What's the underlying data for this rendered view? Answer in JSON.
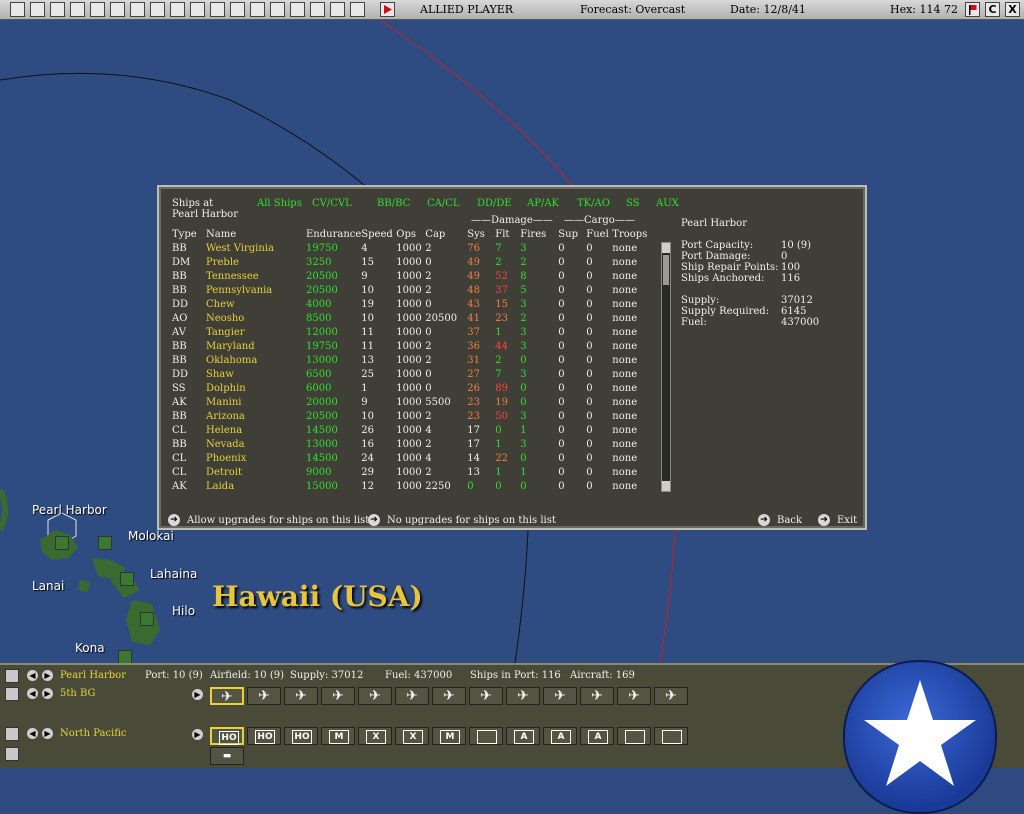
{
  "topbar": {
    "player": "ALLIED PLAYER",
    "forecast": "Forecast: Overcast",
    "date": "Date: 12/8/41",
    "hex": "Hex: 114  72",
    "right_c": "C",
    "right_x": "X"
  },
  "map": {
    "labels": {
      "pearl_harbor": "Pearl Harbor",
      "molokai": "Molokai",
      "lahaina": "Lahaina",
      "lanai": "Lanai",
      "hilo": "Hilo",
      "kona": "Kona",
      "hawaii": "Hawaii (USA)"
    }
  },
  "panel": {
    "header_line1": "Ships at",
    "header_line2": "Pearl Harbor",
    "filters": [
      "All Ships",
      "CV/CVL",
      "BB/BC",
      "CA/CL",
      "DD/DE",
      "AP/AK",
      "TK/AO",
      "SS",
      "AUX"
    ],
    "group_damage": "Damage",
    "group_cargo": "Cargo",
    "columns": [
      "Type",
      "Name",
      "Endurance",
      "Speed",
      "Ops",
      "Cap",
      "Sys",
      "Flt",
      "Fires",
      "Sup",
      "Fuel",
      "Troops"
    ],
    "rows": [
      [
        "BB",
        "West Virginia",
        "19750",
        "4",
        "1000",
        "2",
        "76",
        "7",
        "3",
        "0",
        "0",
        "none"
      ],
      [
        "DM",
        "Preble",
        "3250",
        "15",
        "1000",
        "0",
        "49",
        "2",
        "2",
        "0",
        "0",
        "none"
      ],
      [
        "BB",
        "Tennessee",
        "20500",
        "9",
        "1000",
        "2",
        "49",
        "52",
        "8",
        "0",
        "0",
        "none"
      ],
      [
        "BB",
        "Pennsylvania",
        "20500",
        "10",
        "1000",
        "2",
        "48",
        "37",
        "5",
        "0",
        "0",
        "none"
      ],
      [
        "DD",
        "Chew",
        "4000",
        "19",
        "1000",
        "0",
        "43",
        "15",
        "3",
        "0",
        "0",
        "none"
      ],
      [
        "AO",
        "Neosho",
        "8500",
        "10",
        "1000",
        "20500",
        "41",
        "23",
        "2",
        "0",
        "0",
        "none"
      ],
      [
        "AV",
        "Tangier",
        "12000",
        "11",
        "1000",
        "0",
        "37",
        "1",
        "3",
        "0",
        "0",
        "none"
      ],
      [
        "BB",
        "Maryland",
        "19750",
        "11",
        "1000",
        "2",
        "36",
        "44",
        "3",
        "0",
        "0",
        "none"
      ],
      [
        "BB",
        "Oklahoma",
        "13000",
        "13",
        "1000",
        "2",
        "31",
        "2",
        "0",
        "0",
        "0",
        "none"
      ],
      [
        "DD",
        "Shaw",
        "6500",
        "25",
        "1000",
        "0",
        "27",
        "7",
        "3",
        "0",
        "0",
        "none"
      ],
      [
        "SS",
        "Dolphin",
        "6000",
        "1",
        "1000",
        "0",
        "26",
        "89",
        "0",
        "0",
        "0",
        "none"
      ],
      [
        "AK",
        "Manini",
        "20000",
        "9",
        "1000",
        "5500",
        "23",
        "19",
        "0",
        "0",
        "0",
        "none"
      ],
      [
        "BB",
        "Arizona",
        "20500",
        "10",
        "1000",
        "2",
        "23",
        "50",
        "3",
        "0",
        "0",
        "none"
      ],
      [
        "CL",
        "Helena",
        "14500",
        "26",
        "1000",
        "4",
        "17",
        "0",
        "1",
        "0",
        "0",
        "none"
      ],
      [
        "BB",
        "Nevada",
        "13000",
        "16",
        "1000",
        "2",
        "17",
        "1",
        "3",
        "0",
        "0",
        "none"
      ],
      [
        "CL",
        "Phoenix",
        "14500",
        "24",
        "1000",
        "4",
        "14",
        "22",
        "0",
        "0",
        "0",
        "none"
      ],
      [
        "CL",
        "Detroit",
        "9000",
        "29",
        "1000",
        "2",
        "13",
        "1",
        "1",
        "0",
        "0",
        "none"
      ],
      [
        "AK",
        "Laida",
        "15000",
        "12",
        "1000",
        "2250",
        "0",
        "0",
        "0",
        "0",
        "0",
        "none"
      ]
    ],
    "info": {
      "title": "Pearl Harbor",
      "port_capacity_label": "Port Capacity:",
      "port_capacity": "10 (9)",
      "port_damage_label": "Port Damage:",
      "port_damage": "0",
      "ship_repair_label": "Ship Repair Points:",
      "ship_repair": "100",
      "ships_anchored_label": "Ships Anchored:",
      "ships_anchored": "116",
      "supply_label": "Supply:",
      "supply": "37012",
      "supply_required_label": "Supply Required:",
      "supply_required": "6145",
      "fuel_label": "Fuel:",
      "fuel": "437000"
    },
    "footer": {
      "allow": "Allow upgrades for ships on this list",
      "no": "No upgrades for ships on this list",
      "back": "Back",
      "exit": "Exit"
    }
  },
  "bottom": {
    "base_name": "Pearl Harbor",
    "port": "Port: 10 (9)",
    "airfield": "Airfield: 10 (9)",
    "supply": "Supply: 37012",
    "fuel": "Fuel: 437000",
    "ships_in_port": "Ships in Port: 116",
    "aircraft": "Aircraft: 169",
    "air_unit": "5th BG",
    "region": "North Pacific",
    "units": [
      "HO",
      "HO",
      "HO",
      "M",
      "X",
      "X",
      "M",
      "",
      "A",
      "A",
      "A",
      "",
      ""
    ]
  },
  "colors": {
    "sea": "#2f4c82",
    "panel": "#3f3e37",
    "green_text": "#30e030",
    "yellow_text": "#e8d23a",
    "orange_text": "#f08040",
    "red_text": "#ff4040"
  }
}
